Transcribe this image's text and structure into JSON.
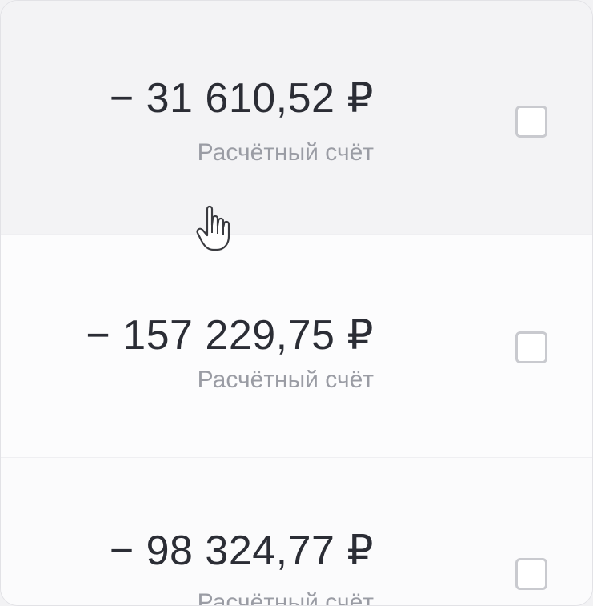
{
  "transactions": [
    {
      "amount": "− 31 610,52 ₽",
      "account": "Расчётный счёт",
      "checked": false
    },
    {
      "amount": "− 157 229,75 ₽",
      "account": "Расчётный счёт",
      "checked": false
    },
    {
      "amount": "− 98 324,77 ₽",
      "account": "Расчётный счёт",
      "checked": false
    }
  ],
  "colors": {
    "amount_text": "#2b2d35",
    "account_text": "#9a9ca4",
    "hover_row_bg": "#f3f3f5",
    "checkbox_border": "#c9cacf"
  },
  "icons": {
    "cursor": "hand-pointer-icon"
  }
}
